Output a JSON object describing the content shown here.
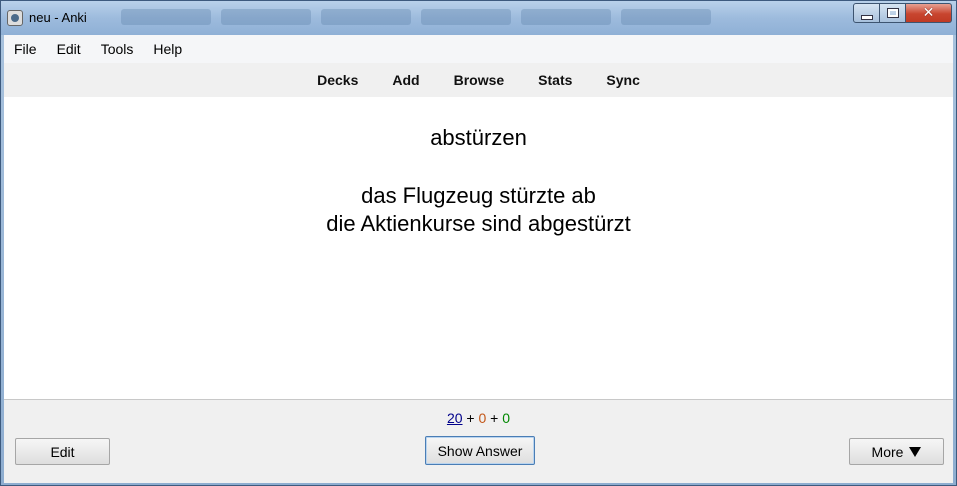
{
  "window": {
    "title": "neu - Anki"
  },
  "menu": {
    "items": [
      "File",
      "Edit",
      "Tools",
      "Help"
    ]
  },
  "toolbar": {
    "links": [
      "Decks",
      "Add",
      "Browse",
      "Stats",
      "Sync"
    ]
  },
  "card": {
    "front": "abstürzen",
    "lines": [
      "das Flugzeug stürzte ab",
      "die Aktienkurse sind abgestürzt"
    ]
  },
  "counts": {
    "new": "20",
    "learning": "0",
    "review": "0",
    "separator": "+",
    "colors": {
      "new": "#00008b",
      "learning": "#c35617",
      "review": "#008800"
    }
  },
  "buttons": {
    "edit": "Edit",
    "show_answer": "Show Answer",
    "more": "More"
  },
  "icons": {
    "app": "anki-icon",
    "more_arrow": "triangle-down-icon"
  }
}
